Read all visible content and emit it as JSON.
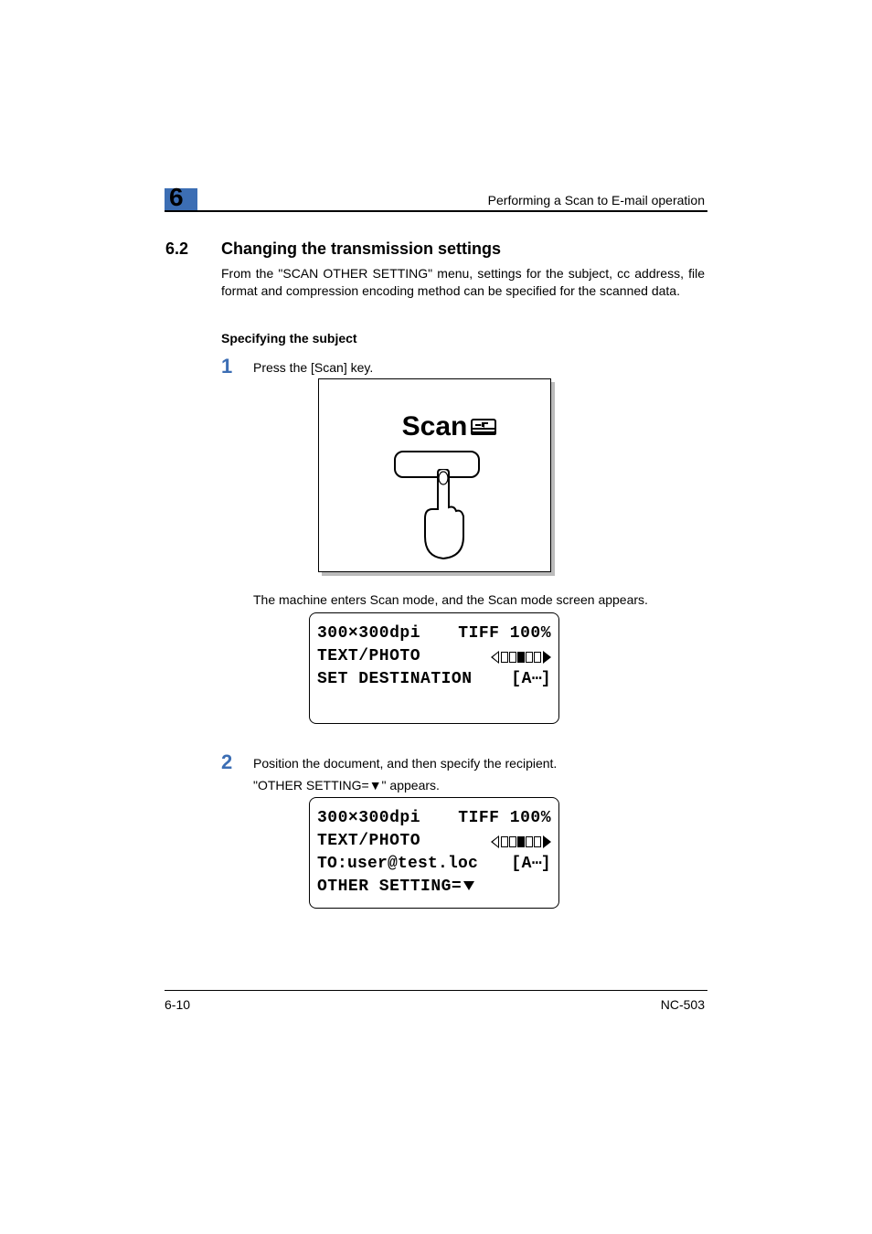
{
  "chapter": "6",
  "header_title": "Performing a Scan to E-mail operation",
  "section_number": "6.2",
  "section_title": "Changing the transmission settings",
  "intro_text": "From the \"SCAN OTHER SETTING\" menu, settings for the subject, cc address, file format and compression encoding method can be specified for the scanned data.",
  "subheading": "Specifying the subject",
  "steps": {
    "s1": {
      "num": "1",
      "text": "Press the [Scan] key."
    },
    "s1_result": "The machine enters Scan mode, and the Scan mode screen appears.",
    "s2": {
      "num": "2",
      "line1": "Position the document, and then specify the recipient.",
      "line2": "\"OTHER SETTING=▼\" appears."
    }
  },
  "scan_key_label": "Scan",
  "lcd1": {
    "row1_left": "300×300dpi",
    "row1_right": "TIFF 100%",
    "row2_left": "TEXT/PHOTO",
    "row3_left": "SET DESTINATION",
    "row3_right": "[A…]"
  },
  "lcd2": {
    "row1_left": "300×300dpi",
    "row1_right": "TIFF 100%",
    "row2_left": "TEXT/PHOTO",
    "row3_left": "TO:user@test.loc",
    "row3_right": "[A…]",
    "row4_left": "OTHER SETTING="
  },
  "footer": {
    "left": "6-10",
    "right": "NC-503"
  }
}
